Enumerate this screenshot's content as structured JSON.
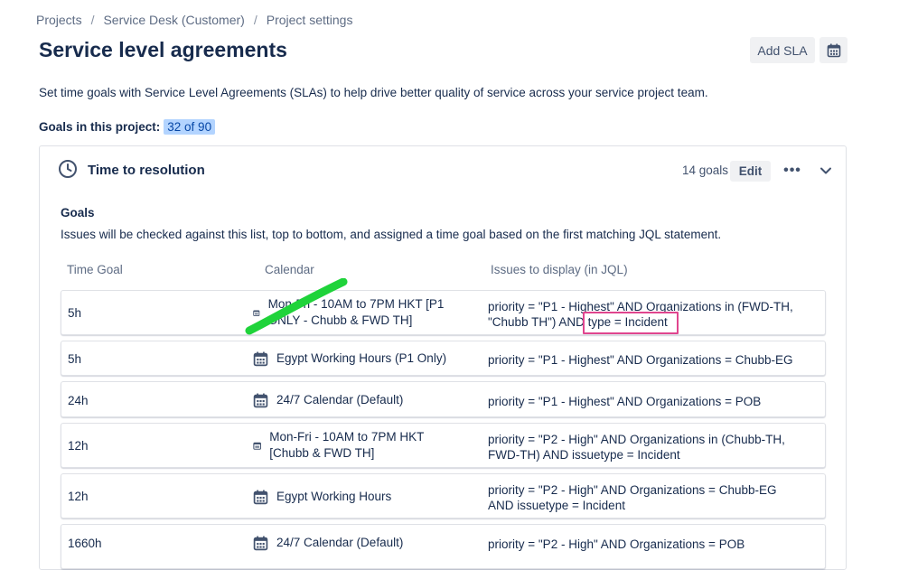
{
  "breadcrumb": [
    "Projects",
    "Service Desk (Customer)",
    "Project settings"
  ],
  "breadcrumb_sep": "/",
  "page_title": "Service level agreements",
  "header": {
    "add_sla_label": "Add SLA",
    "calendar_icon": "calendar-icon"
  },
  "description": "Set time goals with Service Level Agreements (SLAs) to help drive better quality of service across your service project team.",
  "goals_in_project": {
    "label": "Goals in this project:",
    "value": "32 of 90"
  },
  "sla_card": {
    "title": "Time to resolution",
    "icon": "clock-icon",
    "goals_count": "14 goals",
    "edit_label": "Edit",
    "more_label": "•••",
    "goals_heading": "Goals",
    "goals_description": "Issues will be checked against this list, top to bottom, and assigned a time goal based on the first matching JQL statement.",
    "columns": [
      "Time Goal",
      "Calendar",
      "Issues to display (in JQL)"
    ],
    "rows": [
      {
        "goal": "5h",
        "calendar": "Mon-Fri - 10AM to 7PM HKT [P1 ONLY - Chubb & FWD TH]",
        "jql": "priority = \"P1 - Highest\" AND Organizations in (FWD-TH, \"Chubb TH\") AND type = Incident"
      },
      {
        "goal": "5h",
        "calendar": "Egypt Working Hours (P1 Only)",
        "jql": "priority = \"P1 - Highest\" AND Organizations = Chubb-EG"
      },
      {
        "goal": "24h",
        "calendar": "24/7 Calendar (Default)",
        "jql": "priority = \"P1 - Highest\" AND Organizations = POB"
      },
      {
        "goal": "12h",
        "calendar": "Mon-Fri - 10AM to 7PM HKT [Chubb & FWD TH]",
        "jql": "priority = \"P2 - High\" AND Organizations in (Chubb-TH, FWD-TH) AND issuetype = Incident"
      },
      {
        "goal": "12h",
        "calendar": "Egypt Working Hours",
        "jql": "priority = \"P2 - High\" AND Organizations = Chubb-EG AND issuetype = Incident"
      },
      {
        "goal": "1660h",
        "calendar": "24/7 Calendar (Default)",
        "jql": "priority = \"P2 - High\" AND Organizations = POB"
      }
    ]
  },
  "colors": {
    "text": "#172b4d",
    "subtle": "#5e6c84",
    "badge_bg": "#b3d4ff",
    "annotation_pink": "#e0458e",
    "annotation_green": "#1fd33a"
  }
}
